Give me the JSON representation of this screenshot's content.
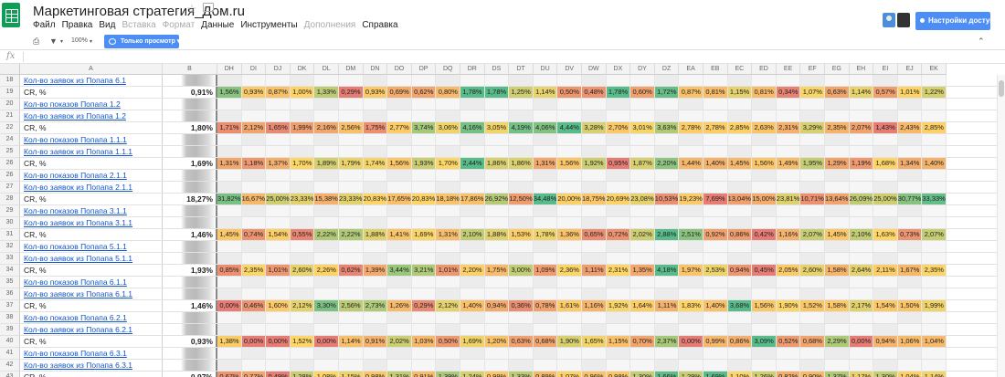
{
  "app": {
    "title": "Маркетинговая стратегия_Дом.ru",
    "menu": [
      "Файл",
      "Правка",
      "Вид",
      "Вставка",
      "Формат",
      "Данные",
      "Инструменты",
      "Дополнения",
      "Справка"
    ],
    "menu_disabled": [
      "Вставка",
      "Формат",
      "Дополнения"
    ],
    "share_label": "Настройки доступа",
    "zoom": "100%",
    "view_only": "Только просмотр",
    "fx": "fx",
    "accent": "#4d8ef6",
    "brand": "#0f9d58"
  },
  "columns": {
    "a": "A",
    "b": "B",
    "data": [
      "DH",
      "DI",
      "DJ",
      "DK",
      "DL",
      "DM",
      "DN",
      "DO",
      "DP",
      "DQ",
      "DR",
      "DS",
      "DT",
      "DU",
      "DV",
      "DW",
      "DX",
      "DY",
      "DZ",
      "EA",
      "EB",
      "EC",
      "ED",
      "EE",
      "EF",
      "EG",
      "EH",
      "EI",
      "EJ",
      "EK"
    ]
  },
  "rows": [
    {
      "n": "18",
      "label": "Кол-во заявок из  Попапа 6.1",
      "link": true
    },
    {
      "n": "19",
      "label": "CR, %",
      "b": "0,91%",
      "values": [
        "1,56%",
        "0,93%",
        "0,87%",
        "1,00%",
        "1,33%",
        "0,29%",
        "0,93%",
        "0,69%",
        "0,62%",
        "0,80%",
        "1,78%",
        "1,78%",
        "1,25%",
        "1,14%",
        "0,50%",
        "0,48%",
        "1,78%",
        "0,60%",
        "1,72%",
        "0,87%",
        "0,81%",
        "1,15%",
        "0,81%",
        "0,34%",
        "1,07%",
        "0,63%",
        "1,14%",
        "0,57%",
        "1,01%",
        "1,22%"
      ]
    },
    {
      "n": "20",
      "label": "Кол-во показов Попапа 1.2",
      "link": true
    },
    {
      "n": "21",
      "label": "Кол-во заявок из  Попапа 1.2",
      "link": true
    },
    {
      "n": "22",
      "label": "CR, %",
      "b": "1,80%",
      "values": [
        "1,71%",
        "2,12%",
        "1,65%",
        "1,99%",
        "2,16%",
        "2,56%",
        "1,75%",
        "2,77%",
        "3,74%",
        "3,06%",
        "4,16%",
        "3,05%",
        "4,19%",
        "4,06%",
        "4,44%",
        "3,28%",
        "2,70%",
        "3,01%",
        "3,63%",
        "2,78%",
        "2,78%",
        "2,85%",
        "2,63%",
        "2,31%",
        "3,29%",
        "2,35%",
        "2,07%",
        "1,43%",
        "2,43%",
        "2,85%"
      ]
    },
    {
      "n": "24",
      "label": "Кол-во показов Попапа 1.1.1",
      "link": true
    },
    {
      "n": "25",
      "label": "Кол-во заявок из Попапа 1.1.1",
      "link": true
    },
    {
      "n": "26",
      "label": "CR, %",
      "b": "1,69%",
      "values": [
        "1,31%",
        "1,18%",
        "1,37%",
        "1,70%",
        "1,89%",
        "1,79%",
        "1,74%",
        "1,56%",
        "1,93%",
        "1,70%",
        "2,44%",
        "1,86%",
        "1,86%",
        "1,31%",
        "1,56%",
        "1,92%",
        "0,95%",
        "1,87%",
        "2,20%",
        "1,44%",
        "1,40%",
        "1,45%",
        "1,56%",
        "1,49%",
        "1,95%",
        "1,29%",
        "1,19%",
        "1,68%",
        "1,34%",
        "1,40%"
      ]
    },
    {
      "n": "26",
      "label": "Кол-во показов Попапа 2.1.1",
      "link": true
    },
    {
      "n": "27",
      "label": "Кол-во заявок из Попапа 2.1.1",
      "link": true
    },
    {
      "n": "28",
      "label": "CR, %",
      "b": "18,27%",
      "values": [
        "31,82%",
        "16,67%",
        "25,00%",
        "23,33%",
        "15,38%",
        "23,33%",
        "20,83%",
        "17,65%",
        "20,83%",
        "18,18%",
        "17,86%",
        "26,92%",
        "12,50%",
        "34,48%",
        "20,00%",
        "18,75%",
        "20,69%",
        "23,08%",
        "10,53%",
        "19,23%",
        "7,69%",
        "13,04%",
        "15,00%",
        "23,81%",
        "10,71%",
        "13,64%",
        "26,09%",
        "25,00%",
        "30,77%",
        "33,33%"
      ]
    },
    {
      "n": "29",
      "label": "Кол-во показов Попапа 3.1.1",
      "link": true
    },
    {
      "n": "30",
      "label": "Кол-во заявок из  Попапа 3.1.1",
      "link": true
    },
    {
      "n": "31",
      "label": "CR, %",
      "b": "1,46%",
      "values": [
        "1,45%",
        "0,74%",
        "1,54%",
        "0,55%",
        "2,22%",
        "2,22%",
        "1,88%",
        "1,41%",
        "1,69%",
        "1,31%",
        "2,10%",
        "1,88%",
        "1,53%",
        "1,78%",
        "1,36%",
        "0,65%",
        "0,72%",
        "2,02%",
        "2,88%",
        "2,51%",
        "0,92%",
        "0,86%",
        "0,42%",
        "1,16%",
        "2,07%",
        "1,45%",
        "2,10%",
        "1,63%",
        "0,73%",
        "2,07%"
      ]
    },
    {
      "n": "32",
      "label": "Кол-во показов Попапа 5.1.1",
      "link": true
    },
    {
      "n": "33",
      "label": "Кол-во заявок из Попапа 5.1.1",
      "link": true
    },
    {
      "n": "34",
      "label": "CR, %",
      "b": "1,93%",
      "values": [
        "0,85%",
        "2,35%",
        "1,01%",
        "2,60%",
        "2,26%",
        "0,62%",
        "1,39%",
        "3,44%",
        "3,21%",
        "1,01%",
        "2,20%",
        "1,75%",
        "3,00%",
        "1,09%",
        "2,36%",
        "1,11%",
        "2,31%",
        "1,35%",
        "4,18%",
        "1,97%",
        "2,53%",
        "0,94%",
        "0,45%",
        "2,05%",
        "2,60%",
        "1,58%",
        "2,64%",
        "2,11%",
        "1,67%",
        "2,35%"
      ]
    },
    {
      "n": "35",
      "label": "Кол-во показов Попапа 6.1.1",
      "link": true
    },
    {
      "n": "36",
      "label": "Кол-во заявок из Попапа 6.1.1",
      "link": true
    },
    {
      "n": "37",
      "label": "CR, %",
      "b": "1,46%",
      "values": [
        "0,00%",
        "0,46%",
        "1,60%",
        "2,12%",
        "3,30%",
        "2,56%",
        "2,73%",
        "1,26%",
        "0,29%",
        "2,12%",
        "1,40%",
        "0,94%",
        "0,36%",
        "0,78%",
        "1,61%",
        "1,16%",
        "1,92%",
        "1,64%",
        "1,11%",
        "1,83%",
        "1,40%",
        "3,68%",
        "1,56%",
        "1,90%",
        "1,52%",
        "1,58%",
        "2,17%",
        "1,54%",
        "1,50%",
        "1,99%"
      ]
    },
    {
      "n": "38",
      "label": "Кол-во показов Попапа 6.2.1",
      "link": true
    },
    {
      "n": "39",
      "label": "Кол-во заявок из Попапа 6.2.1",
      "link": true
    },
    {
      "n": "40",
      "label": "CR, %",
      "b": "0,93%",
      "values": [
        "1,38%",
        "0,00%",
        "0,00%",
        "1,52%",
        "0,00%",
        "1,14%",
        "0,91%",
        "2,02%",
        "1,03%",
        "0,50%",
        "1,69%",
        "1,20%",
        "0,63%",
        "0,68%",
        "1,90%",
        "1,65%",
        "1,15%",
        "0,70%",
        "2,37%",
        "0,00%",
        "0,99%",
        "0,86%",
        "3,09%",
        "0,52%",
        "0,68%",
        "2,29%",
        "0,00%",
        "0,94%",
        "1,06%",
        "1,04%"
      ]
    },
    {
      "n": "41",
      "label": "Кол-во показов Попапа 6.3.1",
      "link": true
    },
    {
      "n": "42",
      "label": "Кол-во заявок из Попапа 6.3.1",
      "link": true
    },
    {
      "n": "43",
      "label": "CR, %",
      "b": "0,97%",
      "values": [
        "0,67%",
        "0,77%",
        "0,49%",
        "1,28%",
        "1,08%",
        "1,15%",
        "0,98%",
        "1,31%",
        "0,91%",
        "1,39%",
        "1,24%",
        "0,99%",
        "1,33%",
        "0,89%",
        "1,07%",
        "0,96%",
        "0,98%",
        "1,30%",
        "1,66%",
        "1,29%",
        "1,69%",
        "1,10%",
        "1,26%",
        "0,82%",
        "0,90%",
        "1,37%",
        "1,17%",
        "1,30%",
        "1,04%",
        "1,14%"
      ]
    }
  ]
}
